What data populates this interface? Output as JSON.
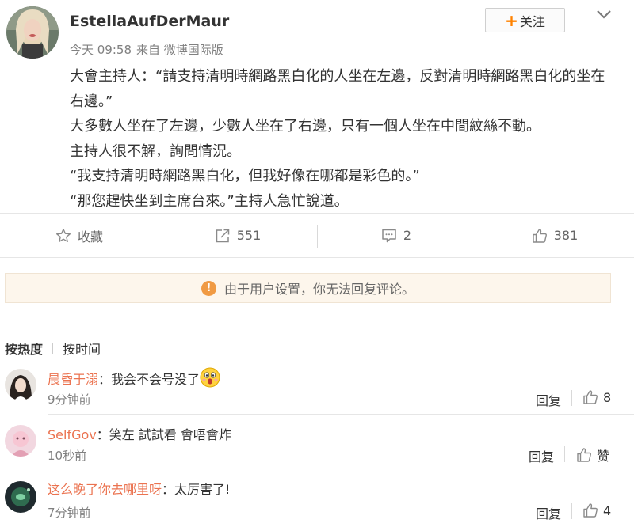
{
  "post": {
    "username": "EstellaAufDerMaur",
    "time": "今天 09:58",
    "source": "来自 微博国际版",
    "follow_label": "关注",
    "body": [
      "大會主持人：“請支持清明時網路黑白化的人坐在左邊，反對清明時網路黑白化的坐在右邊。”",
      "大多數人坐在了左邊，少數人坐在了右邊，只有一個人坐在中間紋絲不動。",
      "主持人很不解，詢問情況。",
      "“我支持清明時網路黑白化，但我好像在哪都是彩色的。”",
      "“那您趕快坐到主席台來。”主持人急忙說道。"
    ]
  },
  "actions": {
    "favorite_label": "收藏",
    "repost_count": "551",
    "comment_count": "2",
    "like_count": "381"
  },
  "notice": {
    "text": "由于用户设置，你无法回复评论。"
  },
  "sort": {
    "hot": "按热度",
    "time": "按时间"
  },
  "comments": [
    {
      "user": "晨昏于溺",
      "text": "我会不会号没了",
      "emoji": "scared-face",
      "time": "9分钟前",
      "reply": "回复",
      "likes": "8"
    },
    {
      "user": "SelfGov",
      "text": "笑左 試試看 會唔會炸",
      "time": "10秒前",
      "reply": "回复",
      "likes": "赞"
    },
    {
      "user": "这么晚了你去哪里呀",
      "text": "太厉害了!",
      "time": "7分钟前",
      "reply": "回复",
      "likes": "4"
    }
  ],
  "colors": {
    "accent": "#ff8200",
    "comment_user": "#eb7350",
    "notice_bg": "#fdf6ec",
    "notice_icon": "#f09a43"
  }
}
